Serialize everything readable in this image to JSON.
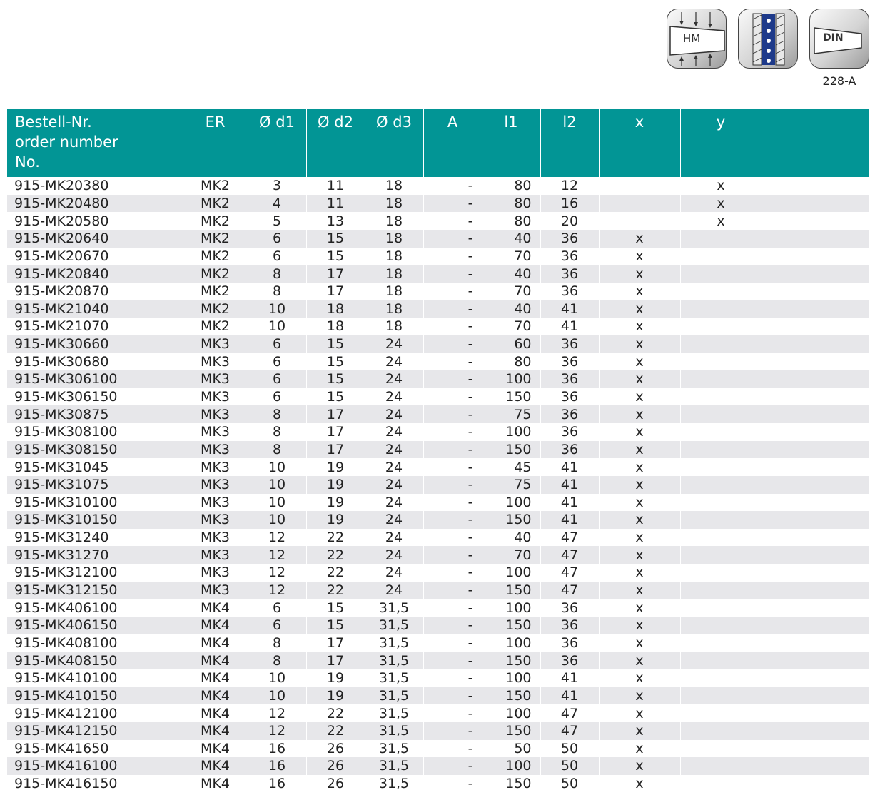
{
  "icons": [
    {
      "name": "hm-clamp-icon",
      "label": "HM"
    },
    {
      "name": "coolant-channel-icon"
    },
    {
      "name": "din-taper-icon",
      "label": "DIN",
      "caption": "228-A"
    }
  ],
  "colors": {
    "header_bg": "#029595",
    "row_alt": "#e7e7ea",
    "header_text": "#ffffff"
  },
  "table": {
    "headers": {
      "order_line1": "Bestell-Nr.",
      "order_line2": "order number",
      "order_line3": "No.",
      "er": "ER",
      "d1": "Ø d1",
      "d2": "Ø d2",
      "d3": "Ø d3",
      "a": "A",
      "l1": "l1",
      "l2": "l2",
      "x": "x",
      "y": "y",
      "extra": ""
    },
    "rows": [
      [
        "915-MK20380",
        "MK2",
        "3",
        "11",
        "18",
        "-",
        "80",
        "12",
        "",
        "x"
      ],
      [
        "915-MK20480",
        "MK2",
        "4",
        "11",
        "18",
        "-",
        "80",
        "16",
        "",
        "x"
      ],
      [
        "915-MK20580",
        "MK2",
        "5",
        "13",
        "18",
        "-",
        "80",
        "20",
        "",
        "x"
      ],
      [
        "915-MK20640",
        "MK2",
        "6",
        "15",
        "18",
        "-",
        "40",
        "36",
        "x",
        ""
      ],
      [
        "915-MK20670",
        "MK2",
        "6",
        "15",
        "18",
        "-",
        "70",
        "36",
        "x",
        ""
      ],
      [
        "915-MK20840",
        "MK2",
        "8",
        "17",
        "18",
        "-",
        "40",
        "36",
        "x",
        ""
      ],
      [
        "915-MK20870",
        "MK2",
        "8",
        "17",
        "18",
        "-",
        "70",
        "36",
        "x",
        ""
      ],
      [
        "915-MK21040",
        "MK2",
        "10",
        "18",
        "18",
        "-",
        "40",
        "41",
        "x",
        ""
      ],
      [
        "915-MK21070",
        "MK2",
        "10",
        "18",
        "18",
        "-",
        "70",
        "41",
        "x",
        ""
      ],
      [
        "915-MK30660",
        "MK3",
        "6",
        "15",
        "24",
        "-",
        "60",
        "36",
        "x",
        ""
      ],
      [
        "915-MK30680",
        "MK3",
        "6",
        "15",
        "24",
        "-",
        "80",
        "36",
        "x",
        ""
      ],
      [
        "915-MK306100",
        "MK3",
        "6",
        "15",
        "24",
        "-",
        "100",
        "36",
        "x",
        ""
      ],
      [
        "915-MK306150",
        "MK3",
        "6",
        "15",
        "24",
        "-",
        "150",
        "36",
        "x",
        ""
      ],
      [
        "915-MK30875",
        "MK3",
        "8",
        "17",
        "24",
        "-",
        "75",
        "36",
        "x",
        ""
      ],
      [
        "915-MK308100",
        "MK3",
        "8",
        "17",
        "24",
        "-",
        "100",
        "36",
        "x",
        ""
      ],
      [
        "915-MK308150",
        "MK3",
        "8",
        "17",
        "24",
        "-",
        "150",
        "36",
        "x",
        ""
      ],
      [
        "915-MK31045",
        "MK3",
        "10",
        "19",
        "24",
        "-",
        "45",
        "41",
        "x",
        ""
      ],
      [
        "915-MK31075",
        "MK3",
        "10",
        "19",
        "24",
        "-",
        "75",
        "41",
        "x",
        ""
      ],
      [
        "915-MK310100",
        "MK3",
        "10",
        "19",
        "24",
        "-",
        "100",
        "41",
        "x",
        ""
      ],
      [
        "915-MK310150",
        "MK3",
        "10",
        "19",
        "24",
        "-",
        "150",
        "41",
        "x",
        ""
      ],
      [
        "915-MK31240",
        "MK3",
        "12",
        "22",
        "24",
        "-",
        "40",
        "47",
        "x",
        ""
      ],
      [
        "915-MK31270",
        "MK3",
        "12",
        "22",
        "24",
        "-",
        "70",
        "47",
        "x",
        ""
      ],
      [
        "915-MK312100",
        "MK3",
        "12",
        "22",
        "24",
        "-",
        "100",
        "47",
        "x",
        ""
      ],
      [
        "915-MK312150",
        "MK3",
        "12",
        "22",
        "24",
        "-",
        "150",
        "47",
        "x",
        ""
      ],
      [
        "915-MK406100",
        "MK4",
        "6",
        "15",
        "31,5",
        "-",
        "100",
        "36",
        "x",
        ""
      ],
      [
        "915-MK406150",
        "MK4",
        "6",
        "15",
        "31,5",
        "-",
        "150",
        "36",
        "x",
        ""
      ],
      [
        "915-MK408100",
        "MK4",
        "8",
        "17",
        "31,5",
        "-",
        "100",
        "36",
        "x",
        ""
      ],
      [
        "915-MK408150",
        "MK4",
        "8",
        "17",
        "31,5",
        "-",
        "150",
        "36",
        "x",
        ""
      ],
      [
        "915-MK410100",
        "MK4",
        "10",
        "19",
        "31,5",
        "-",
        "100",
        "41",
        "x",
        ""
      ],
      [
        "915-MK410150",
        "MK4",
        "10",
        "19",
        "31,5",
        "-",
        "150",
        "41",
        "x",
        ""
      ],
      [
        "915-MK412100",
        "MK4",
        "12",
        "22",
        "31,5",
        "-",
        "100",
        "47",
        "x",
        ""
      ],
      [
        "915-MK412150",
        "MK4",
        "12",
        "22",
        "31,5",
        "-",
        "150",
        "47",
        "x",
        ""
      ],
      [
        "915-MK41650",
        "MK4",
        "16",
        "26",
        "31,5",
        "-",
        "50",
        "50",
        "x",
        ""
      ],
      [
        "915-MK416100",
        "MK4",
        "16",
        "26",
        "31,5",
        "-",
        "100",
        "50",
        "x",
        ""
      ],
      [
        "915-MK416150",
        "MK4",
        "16",
        "26",
        "31,5",
        "-",
        "150",
        "50",
        "x",
        ""
      ]
    ]
  }
}
